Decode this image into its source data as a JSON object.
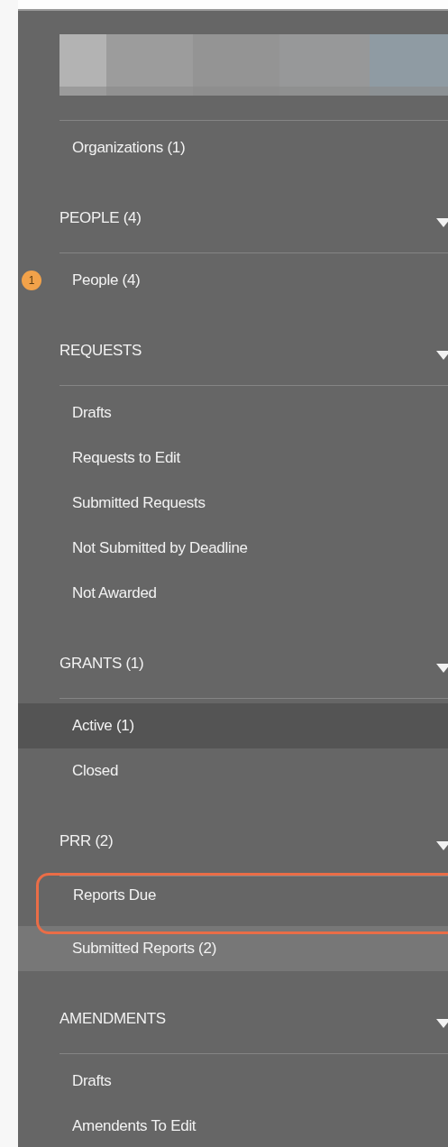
{
  "top_items": [
    {
      "label": "Organizations  (1)",
      "selected": false,
      "outlined": false,
      "hovered": false
    }
  ],
  "sections": [
    {
      "title": "PEOPLE (4)",
      "expanded": true,
      "items": [
        {
          "label": "People  (4)",
          "badge": "1",
          "selected": false,
          "outlined": false,
          "hovered": false
        }
      ]
    },
    {
      "title": "REQUESTS",
      "expanded": true,
      "items": [
        {
          "label": "Drafts",
          "selected": false,
          "outlined": false,
          "hovered": false
        },
        {
          "label": "Requests to Edit",
          "selected": false,
          "outlined": false,
          "hovered": false
        },
        {
          "label": "Submitted Requests",
          "selected": false,
          "outlined": false,
          "hovered": false
        },
        {
          "label": "Not Submitted by Deadline",
          "selected": false,
          "outlined": false,
          "hovered": false
        },
        {
          "label": "Not Awarded",
          "selected": false,
          "outlined": false,
          "hovered": false
        }
      ]
    },
    {
      "title": "GRANTS (1)",
      "expanded": true,
      "items": [
        {
          "label": "Active  (1)",
          "selected": true,
          "outlined": false,
          "hovered": false
        },
        {
          "label": "Closed",
          "selected": false,
          "outlined": false,
          "hovered": false
        }
      ]
    },
    {
      "title": "PRR (2)",
      "expanded": true,
      "items": [
        {
          "label": "Reports Due",
          "selected": false,
          "outlined": true,
          "hovered": false
        },
        {
          "label": "Submitted Reports  (2)",
          "selected": false,
          "outlined": false,
          "hovered": true
        }
      ]
    },
    {
      "title": "AMENDMENTS",
      "expanded": true,
      "items": [
        {
          "label": "Drafts",
          "selected": false,
          "outlined": false,
          "hovered": false
        },
        {
          "label": "Amendents To Edit",
          "selected": false,
          "outlined": false,
          "hovered": false
        }
      ]
    }
  ]
}
